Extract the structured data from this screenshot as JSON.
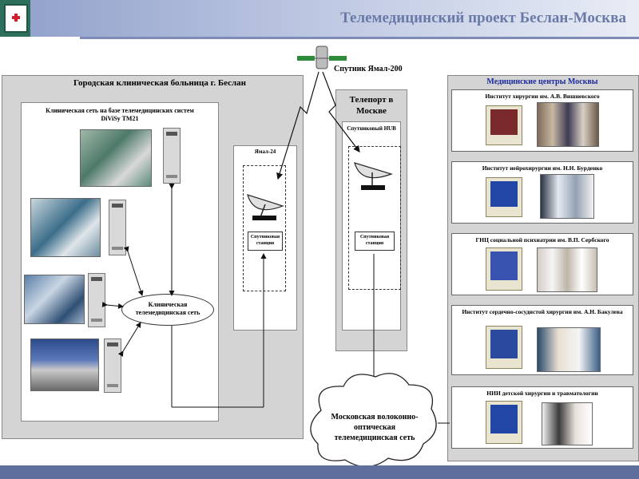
{
  "header": {
    "title": "Телемедицинский проект Беслан-Москва"
  },
  "satellite": {
    "label": "Спутник Ямал-200"
  },
  "hospital": {
    "title": "Городская клиническая больница г. Беслан",
    "network_title": "Клиническая сеть на базе телемедицинских систем DiViSy ТМ21",
    "clinical_network": "Клиническая телемедицинская сеть"
  },
  "yamal": {
    "title": "Ямал-24",
    "station": "Спутниковая станция"
  },
  "teleport": {
    "title": "Телепорт в Москве",
    "hub": "Спутниковый HUB",
    "station": "Спутниковая станция"
  },
  "moscow_network": "Московская волоконно-оптическая телемедицинская сеть",
  "centers": {
    "title": "Медицинские центры Москвы",
    "items": [
      {
        "label": "Институт хирургии им. А.В. Вишневского"
      },
      {
        "label": "Институт нейрохирургии им. Н.Н. Бурденко"
      },
      {
        "label": "ГНЦ социальной психиатрии им. В.П. Сербского"
      },
      {
        "label": "Институт сердечно-сосудистой хирургии им. А.Н. Бакулева"
      },
      {
        "label": "НИИ детской хирургии и травматологии"
      }
    ]
  },
  "colors": {
    "header_gradient_start": "#8f9fc9",
    "header_title": "#6a7aa8",
    "centers_title": "#1a2a9c",
    "footer": "#5e6f9d",
    "panel_bg": "#d4d4d4"
  }
}
